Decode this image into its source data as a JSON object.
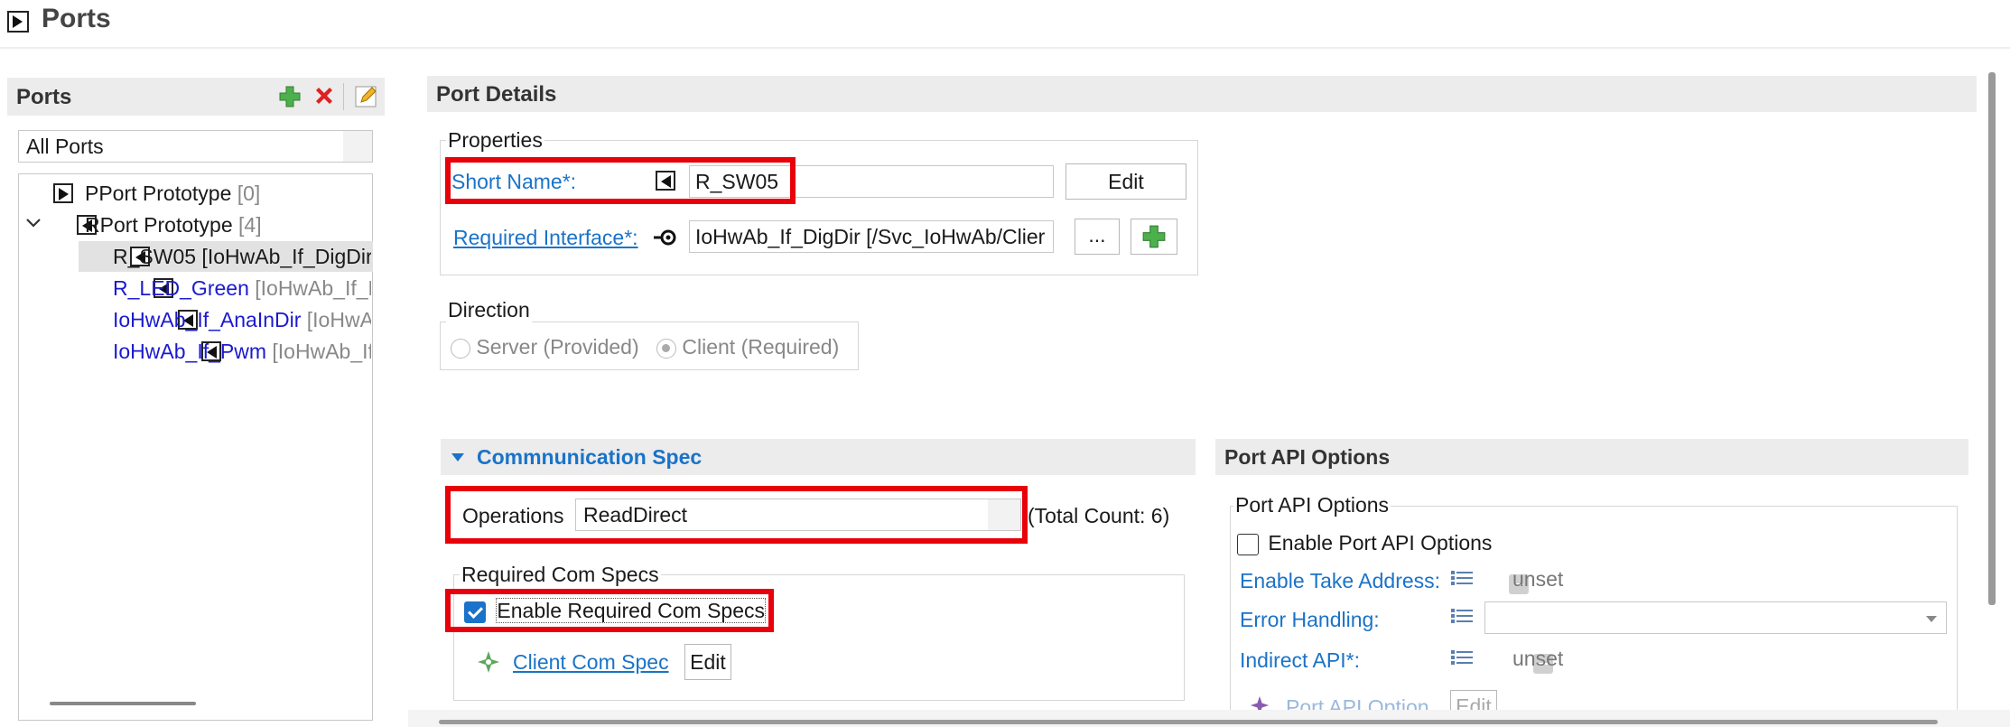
{
  "header": {
    "title": "Ports"
  },
  "left": {
    "title": "Ports",
    "filter_value": "All Ports",
    "tree": {
      "pport": {
        "label": "PPort Prototype",
        "count": "[0]"
      },
      "rport": {
        "label": "RPort Prototype",
        "count": "[4]"
      },
      "items": [
        {
          "name": "R_SW05",
          "detail": " [IoHwAb_If_DigDir",
          "selected": true
        },
        {
          "name": "R_LED_Green",
          "detail": " [IoHwAb_If_D"
        },
        {
          "name": "IoHwAb_If_AnaInDir",
          "detail": " [IoHwA"
        },
        {
          "name": "IoHwAb_If_Pwm",
          "detail": " [IoHwAb_If"
        }
      ]
    }
  },
  "details": {
    "title": "Port Details",
    "properties_label": "Properties",
    "short_name_label": "Short Name*:",
    "short_name_value": "R_SW05",
    "edit_label": "Edit",
    "required_interface_label": "Required Interface*:",
    "required_interface_value": "IoHwAb_If_DigDir [/Svc_IoHwAb/Clier",
    "browse_label": "...",
    "direction_label": "Direction",
    "server_label": "Server (Provided)",
    "client_label": "Client (Required)"
  },
  "comm_spec": {
    "title": "Commnunication Spec",
    "operations_label": "Operations",
    "operations_value": "ReadDirect",
    "total_count": "(Total Count: 6)",
    "required_group_label": "Required Com Specs",
    "enable_label": "Enable Required Com Specs",
    "client_com_spec_label": "Client Com Spec",
    "edit_label": "Edit"
  },
  "port_api": {
    "title": "Port API Options",
    "group_label": "Port API Options",
    "enable_label": "Enable Port API Options",
    "take_address_label": "Enable Take Address:",
    "take_address_value": "unset",
    "error_handling_label": "Error Handling:",
    "indirect_api_label": "Indirect API*:",
    "indirect_api_value": "unset",
    "port_api_option_label": "Port API Option",
    "edit_label": "Edit"
  },
  "colors": {
    "accent": "#1a73c8",
    "highlight": "#e8000b",
    "plus": "#3aa53a",
    "delete": "#e02020"
  }
}
